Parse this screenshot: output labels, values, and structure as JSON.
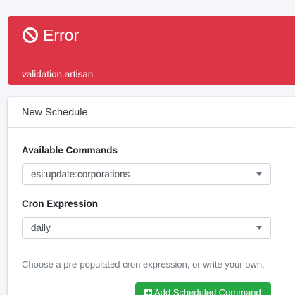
{
  "alert": {
    "icon": "ban-icon",
    "title": "Error",
    "message": "validation.artisan",
    "color": "#dc3545"
  },
  "card": {
    "header": "New Schedule",
    "command_label": "Available Commands",
    "command_value": "esi:update:corporations",
    "cron_label": "Cron Expression",
    "cron_value": "daily",
    "help_text": "Choose a pre-populated cron expression, or write your own.",
    "button_label": "Add Scheduled Command",
    "button_icon": "plus-square-icon",
    "button_color": "#28a745"
  }
}
